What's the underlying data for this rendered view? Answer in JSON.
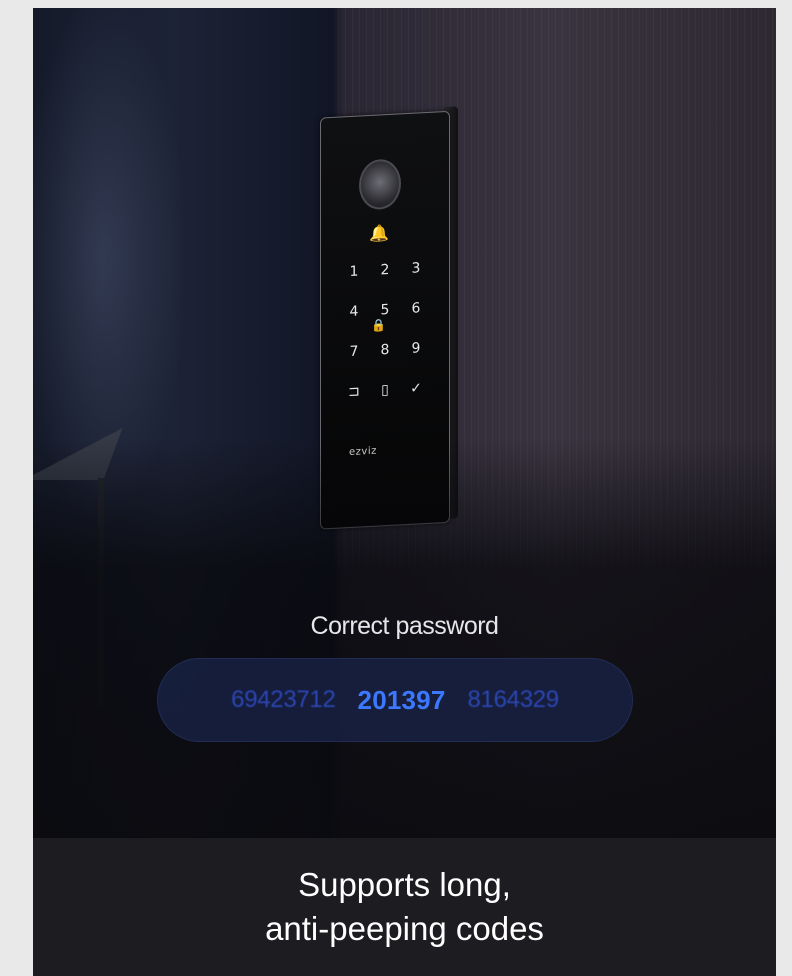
{
  "device": {
    "keypad": [
      "1",
      "2",
      "3",
      "4",
      "5",
      "6",
      "7",
      "8",
      "9",
      "⊐",
      "▯",
      "✓"
    ],
    "bell_icon": "bell-icon",
    "lock_icon": "lock-icon",
    "fingerprint_icon": "fingerprint-sensor",
    "brand": "ezviz"
  },
  "password_panel": {
    "title": "Correct password",
    "codes": {
      "left": "69423712",
      "center": "201397",
      "right": "8164329"
    }
  },
  "caption": {
    "line1": "Supports long,",
    "line2": "anti-peeping codes"
  },
  "colors": {
    "code_highlight": "#3c78ff",
    "code_dim": "#2d47b4",
    "caption_bg": "#1c1c21"
  }
}
